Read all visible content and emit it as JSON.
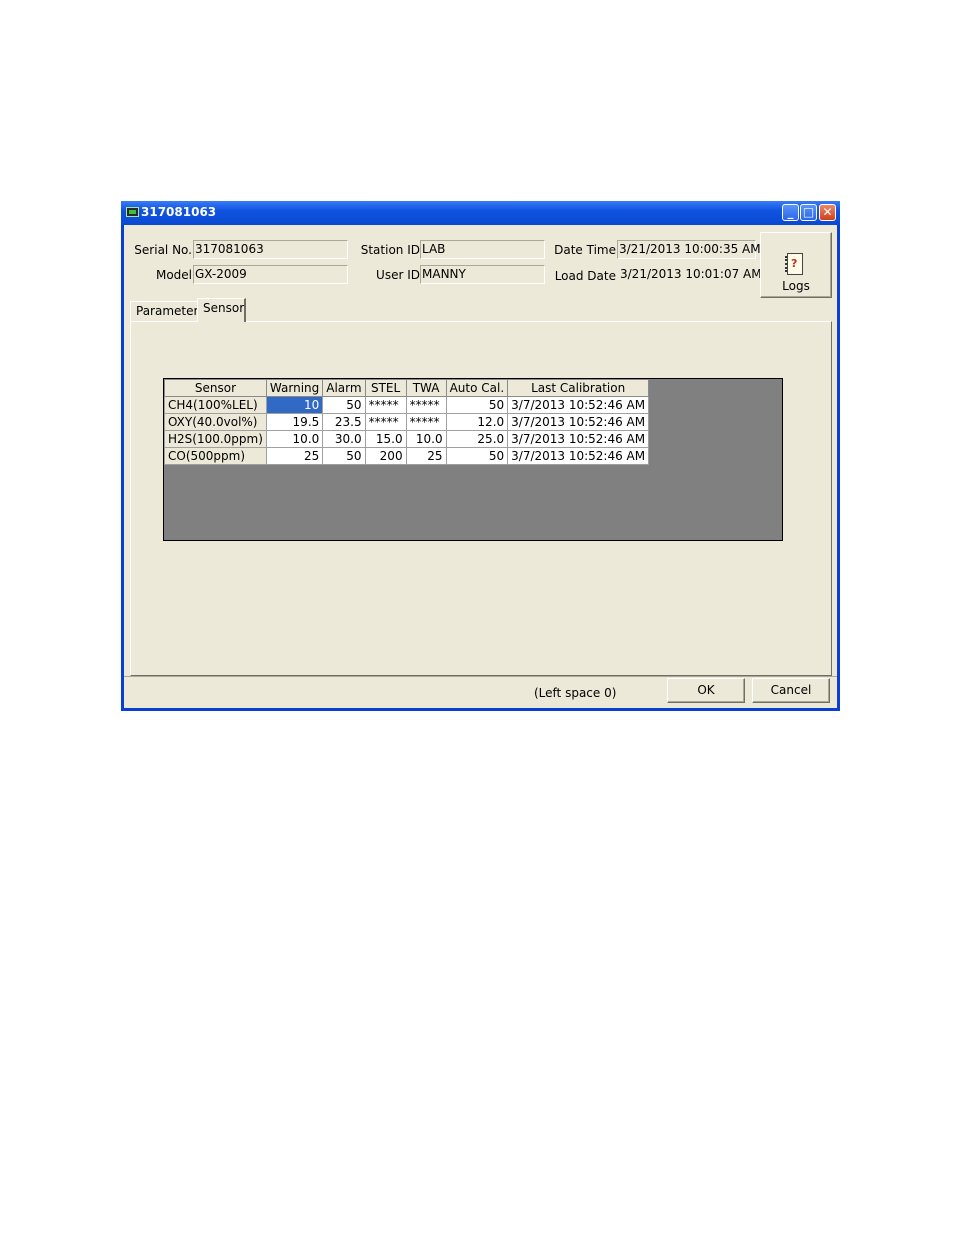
{
  "window": {
    "title": "317081063"
  },
  "header": {
    "serial_label": "Serial No.",
    "serial_value": "317081063",
    "model_label": "Model",
    "model_value": "GX-2009",
    "station_label": "Station ID",
    "station_value": "LAB",
    "user_label": "User ID",
    "user_value": "MANNY",
    "datetime_label": "Date Time",
    "datetime_value": "3/21/2013 10:00:35 AM",
    "loaddate_label": "Load Date",
    "loaddate_value": "3/21/2013 10:01:07 AM",
    "logs_label": "Logs"
  },
  "tabs": [
    {
      "label": "Parameter"
    },
    {
      "label": "Sensor"
    }
  ],
  "table": {
    "headers": [
      "Sensor",
      "Warning",
      "Alarm",
      "STEL",
      "TWA",
      "Auto Cal.",
      "Last Calibration"
    ],
    "rows": [
      [
        "CH4(100%LEL)",
        "10",
        "50",
        "*****",
        "*****",
        "50",
        "3/7/2013 10:52:46 AM"
      ],
      [
        "OXY(40.0vol%)",
        "19.5",
        "23.5",
        "*****",
        "*****",
        "12.0",
        "3/7/2013 10:52:46 AM"
      ],
      [
        "H2S(100.0ppm)",
        "10.0",
        "30.0",
        "15.0",
        "10.0",
        "25.0",
        "3/7/2013 10:52:46 AM"
      ],
      [
        "CO(500ppm)",
        "25",
        "50",
        "200",
        "25",
        "50",
        "3/7/2013 10:52:46 AM"
      ]
    ]
  },
  "footer": {
    "status": "(Left space 0)",
    "ok_label": "OK",
    "cancel_label": "Cancel"
  },
  "colors": {
    "titlebar": "#0a49d2",
    "dialog_bg": "#ece9d8",
    "selection": "#316ac5",
    "grid_bg": "#808080"
  }
}
